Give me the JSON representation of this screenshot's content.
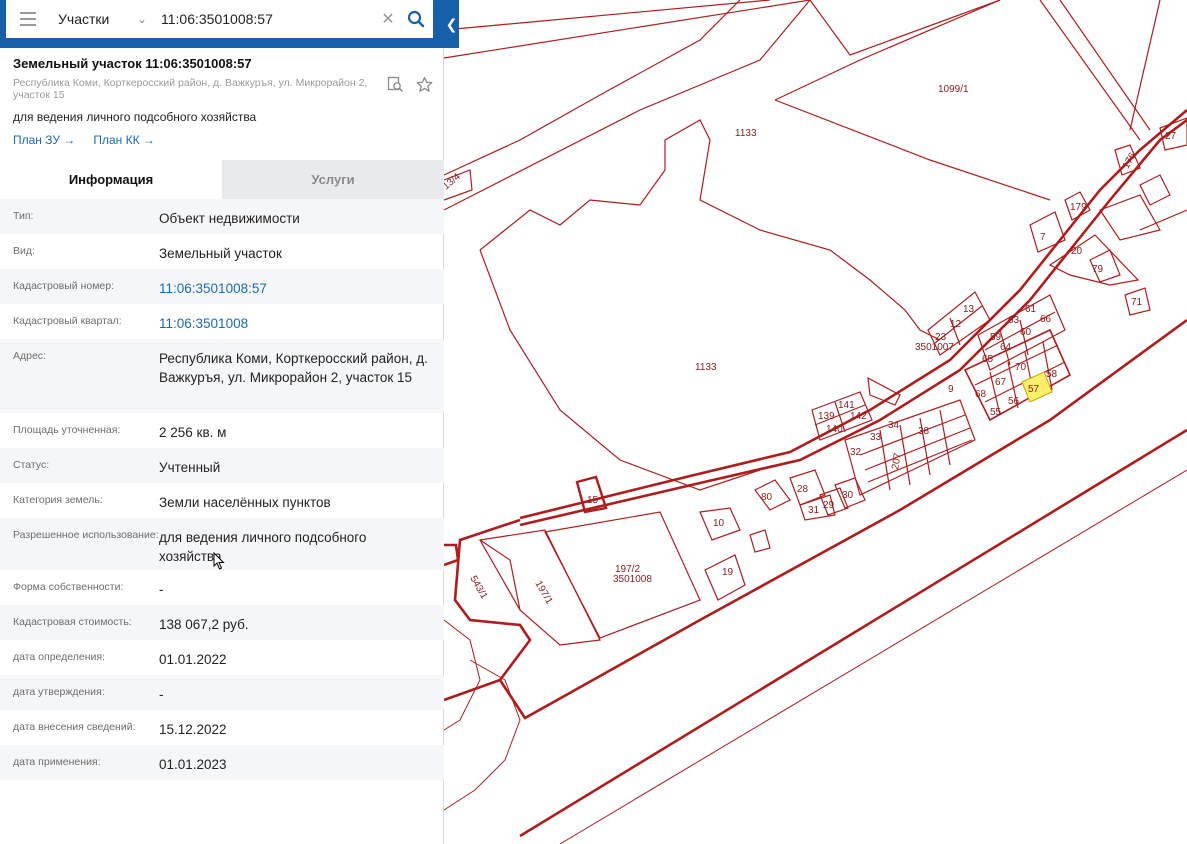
{
  "search": {
    "type_label": "Участки",
    "query": "11:06:3501008:57"
  },
  "object": {
    "title": "Земельный участок 11:06:3501008:57",
    "address_short": "Республика Коми, Корткеросский район, д. Важкуръя, ул. Микрорайон 2, участок 15",
    "purpose": "для ведения личного подсобного хозяйства",
    "links": [
      "План ЗУ →",
      "План КК →"
    ]
  },
  "tabs": [
    {
      "label": "Информация",
      "active": true
    },
    {
      "label": "Услуги",
      "active": false
    }
  ],
  "rows": [
    {
      "label": "Тип:",
      "value": "Объект недвижимости"
    },
    {
      "label": "Вид:",
      "value": "Земельный участок"
    },
    {
      "label": "Кадастровый номер:",
      "value": "11:06:3501008:57",
      "link": true
    },
    {
      "label": "Кадастровый квартал:",
      "value": "11:06:3501008",
      "link": true
    },
    {
      "label": "Адрес:",
      "value": "Республика Коми, Корткеросский район, д. Важкуръя, ул. Микрорайон 2, участок 15"
    },
    {
      "label": "Площадь уточненная:",
      "value": "2 256 кв. м"
    },
    {
      "label": "Статус:",
      "value": "Учтенный"
    },
    {
      "label": "Категория земель:",
      "value": "Земли населённых пунктов"
    },
    {
      "label": "Разрешенное использование:",
      "value": "для ведения личного подсобного хозяйства"
    },
    {
      "label": "Форма собственности:",
      "value": "-"
    },
    {
      "label": "Кадастровая стоимость:",
      "value": "138 067,2 руб."
    },
    {
      "label": "дата определения:",
      "value": "01.01.2022"
    },
    {
      "label": "дата утверждения:",
      "value": "-"
    },
    {
      "label": "дата внесения сведений:",
      "value": "15.12.2022"
    },
    {
      "label": "дата применения:",
      "value": "01.01.2023"
    }
  ],
  "map": {
    "colors": {
      "boundary": "#b01c1c",
      "selected": "#ffef6a"
    },
    "labels": [
      "1099/1",
      "1133",
      "1133",
      "3501007",
      "197/2",
      "3501008",
      "543/1",
      "197/1",
      "15",
      "10",
      "19",
      "80",
      "28",
      "29",
      "30",
      "31",
      "32",
      "33",
      "34",
      "38",
      "207",
      "139",
      "140",
      "141",
      "142",
      "13",
      "12",
      "23",
      "7",
      "20",
      "79",
      "71",
      "176",
      "179",
      "27",
      "59",
      "61",
      "63",
      "64",
      "65",
      "66",
      "60",
      "67",
      "68",
      "70",
      "57",
      "58",
      "55",
      "56",
      "9",
      "13/4"
    ],
    "selected_label": "57"
  }
}
